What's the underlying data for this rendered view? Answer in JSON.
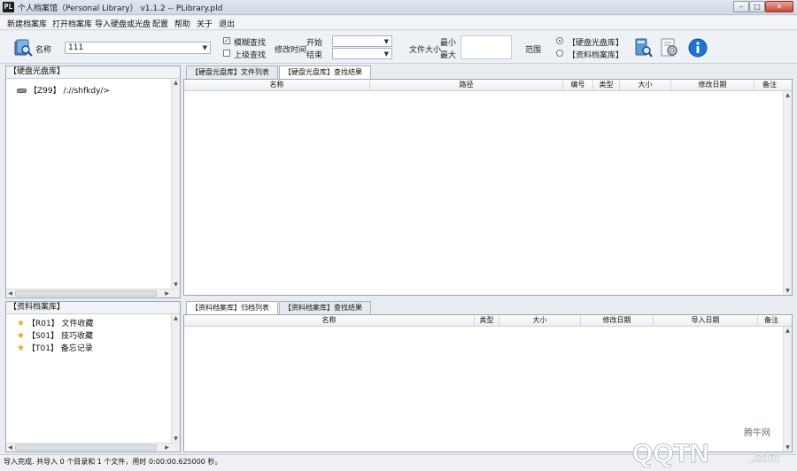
{
  "window": {
    "app_icon_text": "PL",
    "title": "个人档案馆（Personal Library） v1.1.2 -- PLibrary.pld",
    "minimize_glyph": "–",
    "maximize_glyph": "□",
    "close_glyph": "✕"
  },
  "menu": [
    "新建档案库",
    "打开档案库",
    "导入硬盘或光盘",
    "配置",
    "帮助",
    "关于",
    "退出"
  ],
  "toolbar": {
    "search_icon": "search-icon",
    "name_label": "名称",
    "name_value": "111",
    "fuzzy_label": "模糊查找",
    "fuzzy_checked": true,
    "parent_label": "上级查找",
    "parent_checked": false,
    "modtime_label": "修改时间",
    "start_label": "开始",
    "end_label": "结束",
    "filesize_label": "文件大小",
    "min_label": "最小",
    "max_label": "最大",
    "range_label": "范围",
    "range_option_disk": "【硬盘光盘库】",
    "range_option_doc": "【资料档案库】",
    "range_selected": "disk",
    "icons": [
      "search-database-icon",
      "settings-icon",
      "info-icon"
    ]
  },
  "disk_tree": {
    "header": "【硬盘光盘库】",
    "items": [
      {
        "label": "【Z99】 /://shfkdy/>",
        "icon": "disk-icon"
      }
    ]
  },
  "doc_tree": {
    "header": "【资料档案库】",
    "items": [
      {
        "label": "【R01】 文件收藏",
        "icon": "star-icon"
      },
      {
        "label": "【S01】 技巧收藏",
        "icon": "star-icon"
      },
      {
        "label": "【T01】 备忘记录",
        "icon": "star-icon"
      }
    ]
  },
  "top_tabs": [
    "【硬盘光盘库】文件列表",
    "【硬盘光盘库】查找结果"
  ],
  "top_active_tab": 1,
  "top_columns": [
    "名称",
    "路径",
    "编号",
    "类型",
    "大小",
    "修改日期",
    "备注"
  ],
  "bottom_tabs": [
    "【资料档案库】归档列表",
    "【资料档案库】查找结果"
  ],
  "bottom_active_tab": 0,
  "bottom_columns": [
    "名称",
    "类型",
    "大小",
    "修改日期",
    "导入日期",
    "备注"
  ],
  "status": "导入完成. 共导入 0 个目录和 1 个文件，用时 0:00:00.625000 秒。",
  "watermark": {
    "small": "腾牛网",
    "big": "QQTN",
    "domain": ".com"
  }
}
